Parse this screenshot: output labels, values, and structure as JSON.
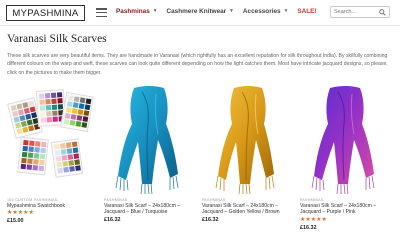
{
  "header": {
    "logo": "MYPASHMINA",
    "nav": [
      {
        "label": "Pashminas",
        "caret": "▼"
      },
      {
        "label": "Cashmere Knitwear",
        "caret": "▼"
      },
      {
        "label": "Accessories",
        "caret": "▼"
      },
      {
        "label": "SALE!",
        "caret": ""
      }
    ],
    "search_placeholder": "Search..."
  },
  "page": {
    "title": "Varanasi Silk Scarves",
    "description": "These silk scarves are very beautiful items. They are handmade in Varanasi (which rightfully has an excellent reputation for silk throughout India). By skilfully combining different colours on the warp and weft, these scarves can look quite different depending on how the light catches them. Most have intricate jacquard designs, so please, click on the pictures to make them bigger."
  },
  "products": [
    {
      "category": "100 CUSTOM PASHMINAS",
      "name": "Mypashmina Swatchbook",
      "stars": "★★★★★",
      "price": "£15.00",
      "image": "swatchbook",
      "colors": [
        "#c83a3a",
        "#e8a0b0"
      ]
    },
    {
      "category": "PASHMINAS",
      "name": "Varanasi Silk Scarf – 24x180cm – Jacquard – Blue / Turquoise",
      "stars": "",
      "price": "£16.32",
      "image": "scarf-blue",
      "colors": [
        "#1aa0c8",
        "#0d6f96"
      ]
    },
    {
      "category": "PASHMINAS",
      "name": "Varanasi Silk Scarf – 24x180cm – Jacquard – Golden Yellow / Brown",
      "stars": "",
      "price": "£16.32",
      "image": "scarf-gold",
      "colors": [
        "#e0a41c",
        "#b8780e"
      ]
    },
    {
      "category": "PASHMINAS",
      "name": "Varanasi Silk Scarf – 24x180cm – Jacquard – Purple / Pink",
      "stars": "★★★★★",
      "price": "£16.32",
      "image": "scarf-purple",
      "colors": [
        "#8a2cc8",
        "#d04aa0"
      ]
    }
  ]
}
